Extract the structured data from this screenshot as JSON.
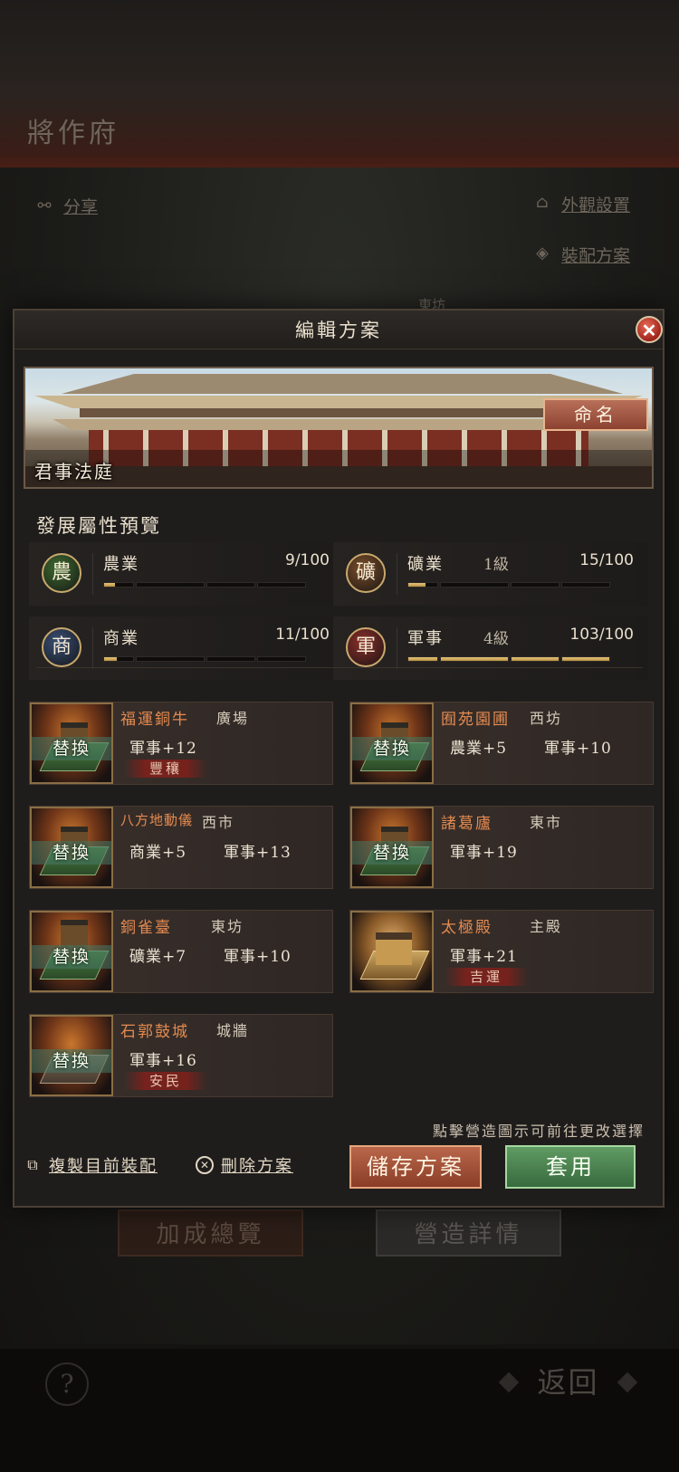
{
  "background": {
    "page_title": "將作府",
    "share_label": "分享",
    "appearance_label": "外觀設置",
    "loadout_label": "裝配方案",
    "market_label": "東坊",
    "bonus_overview_label": "加成總覽",
    "build_detail_label": "營造詳情",
    "help_label": "?",
    "back_label": "返回"
  },
  "dialog": {
    "title": "編輯方案",
    "close_label": "✕",
    "banner_name": "君事法庭",
    "rename_label": "命名",
    "preview_title": "發展屬性預覽",
    "stats": [
      {
        "icon_char": "農",
        "name": "農業",
        "level": "",
        "value_text": "9/100",
        "fill": [
          0.36,
          0,
          0,
          0
        ],
        "color": "#3f6a31"
      },
      {
        "icon_char": "礦",
        "name": "礦業",
        "level": "1級",
        "value_text": "15/100",
        "fill": [
          0.6,
          0,
          0,
          0
        ],
        "color": "#7a4e2a"
      },
      {
        "icon_char": "商",
        "name": "商業",
        "level": "",
        "value_text": "11/100",
        "fill": [
          0.44,
          0,
          0,
          0
        ],
        "color": "#3a4f75"
      },
      {
        "icon_char": "軍",
        "name": "軍事",
        "level": "4級",
        "value_text": "103/100",
        "fill": [
          1,
          1,
          1,
          1
        ],
        "color": "#8a2f2a"
      }
    ],
    "buildings": [
      {
        "name": "福運銅牛",
        "location": "廣場",
        "bonuses": [
          "軍事+12"
        ],
        "tag": "豐穰",
        "swap_label": "替換"
      },
      {
        "name": "囿苑園圃",
        "location": "西坊",
        "bonuses": [
          "農業+5",
          "軍事+10"
        ],
        "tag": "",
        "swap_label": "替換"
      },
      {
        "name": "八方地動儀",
        "location": "西市",
        "bonuses": [
          "商業+5",
          "軍事+13"
        ],
        "tag": "",
        "swap_label": "替換"
      },
      {
        "name": "諸葛廬",
        "location": "東市",
        "bonuses": [
          "軍事+19"
        ],
        "tag": "",
        "swap_label": "替換"
      },
      {
        "name": "銅雀臺",
        "location": "東坊",
        "bonuses": [
          "礦業+7",
          "軍事+10"
        ],
        "tag": "",
        "swap_label": "替換"
      },
      {
        "name": "太極殿",
        "location": "主殿",
        "bonuses": [
          "軍事+21"
        ],
        "tag": "吉運",
        "swap_label": ""
      },
      {
        "name": "石郭鼓城",
        "location": "城牆",
        "bonuses": [
          "軍事+16"
        ],
        "tag": "安民",
        "swap_label": "替換"
      }
    ],
    "hint": "點擊營造圖示可前往更改選擇",
    "copy_label": "複製目前裝配",
    "delete_label": "刪除方案",
    "save_label": "儲存方案",
    "apply_label": "套用"
  },
  "icons": [
    "share-icon",
    "appearance-icon",
    "loadout-icon",
    "close-icon",
    "copy-icon",
    "delete-icon",
    "help-icon"
  ]
}
